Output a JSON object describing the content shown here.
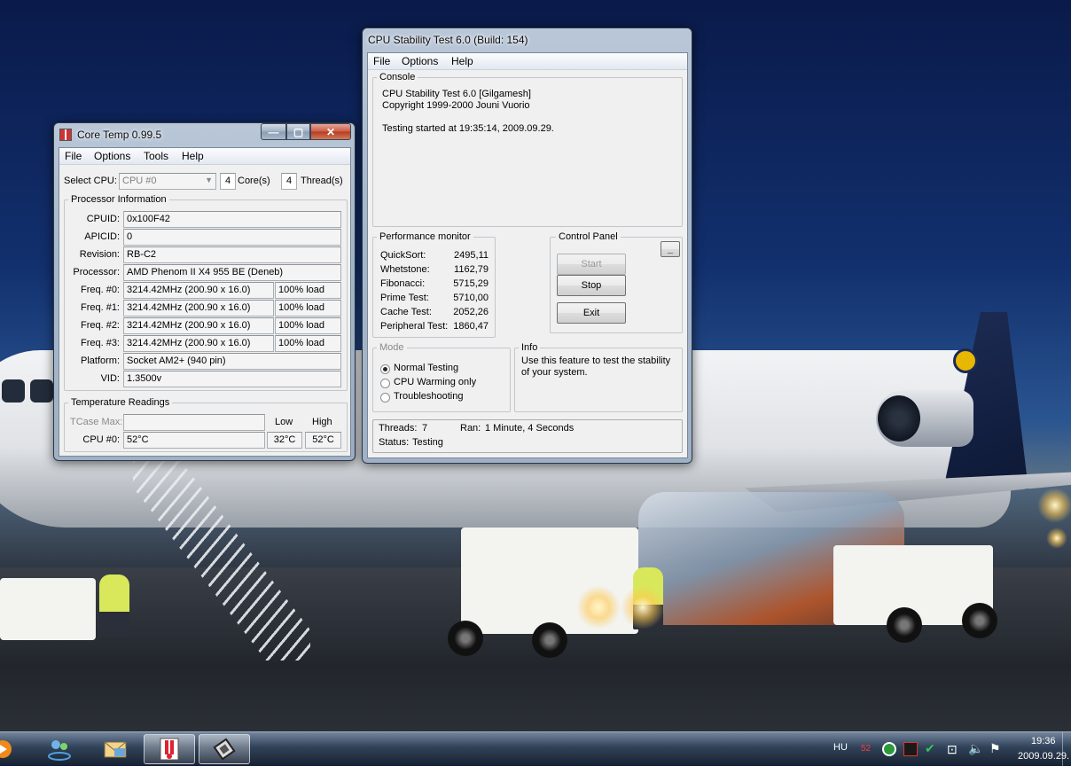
{
  "core_temp": {
    "title": "Core Temp 0.99.5",
    "menu": [
      "File",
      "Options",
      "Tools",
      "Help"
    ],
    "select_cpu_label": "Select CPU:",
    "select_cpu_value": "CPU #0",
    "cores_count": "4",
    "cores_label": "Core(s)",
    "threads_count": "4",
    "threads_label": "Thread(s)",
    "processor_info_title": "Processor Information",
    "info_rows": [
      {
        "label": "CPUID:",
        "value": "0x100F42"
      },
      {
        "label": "APICID:",
        "value": "0"
      },
      {
        "label": "Revision:",
        "value": "RB-C2"
      },
      {
        "label": "Processor:",
        "value": "AMD Phenom II X4 955 BE (Deneb)"
      }
    ],
    "freq_rows": [
      {
        "label": "Freq. #0:",
        "value": "3214.42MHz (200.90 x 16.0)",
        "load": "100% load"
      },
      {
        "label": "Freq. #1:",
        "value": "3214.42MHz (200.90 x 16.0)",
        "load": "100% load"
      },
      {
        "label": "Freq. #2:",
        "value": "3214.42MHz (200.90 x 16.0)",
        "load": "100% load"
      },
      {
        "label": "Freq. #3:",
        "value": "3214.42MHz (200.90 x 16.0)",
        "load": "100% load"
      }
    ],
    "platform_label": "Platform:",
    "platform_value": "Socket AM2+ (940 pin)",
    "vid_label": "VID:",
    "vid_value": "1.3500v",
    "temp_title": "Temperature Readings",
    "tcase_label": "TCase Max:",
    "tcase_value": "",
    "low_label": "Low",
    "high_label": "High",
    "cpu0_label": "CPU #0:",
    "cpu0_temp": "52°C",
    "cpu0_low": "32°C",
    "cpu0_high": "52°C"
  },
  "stability": {
    "title": "CPU Stability Test 6.0 (Build: 154)",
    "menu": [
      "File",
      "Options",
      "Help"
    ],
    "console_title": "Console",
    "console_lines": [
      "CPU Stability Test 6.0 [Gilgamesh]",
      "Copyright 1999-2000 Jouni Vuorio",
      "",
      "Testing started at 19:35:14, 2009.09.29."
    ],
    "perf_title": "Performance monitor",
    "perf_rows": [
      {
        "label": "QuickSort:",
        "value": "2495,11"
      },
      {
        "label": "Whetstone:",
        "value": "1162,79"
      },
      {
        "label": "Fibonacci:",
        "value": "5715,29"
      },
      {
        "label": "Prime Test:",
        "value": "5710,00"
      },
      {
        "label": "Cache Test:",
        "value": "2052,26"
      },
      {
        "label": "Peripheral Test:",
        "value": "1860,47"
      }
    ],
    "control_title": "Control Panel",
    "minimize_label": "_",
    "start_label": "Start",
    "stop_label": "Stop",
    "exit_label": "Exit",
    "mode_title": "Mode",
    "modes": [
      {
        "label": "Normal Testing",
        "selected": true
      },
      {
        "label": "CPU Warming only",
        "selected": false
      },
      {
        "label": "Troubleshooting",
        "selected": false
      }
    ],
    "info_title": "Info",
    "info_text": "Use this feature to test the stability of your system.",
    "threads_label": "Threads:",
    "threads_value": "7",
    "ran_label": "Ran:",
    "ran_value": "1 Minute, 4 Seconds",
    "status_label": "Status:",
    "status_value": "Testing"
  },
  "taskbar": {
    "language": "HU",
    "temp_badge": "52",
    "clock_time": "19:36",
    "clock_date": "2009.09.29.",
    "icons": [
      "media-player-icon",
      "network-people-icon",
      "email-icon",
      "core-temp-taskbar-icon",
      "cpu-stability-taskbar-icon"
    ]
  },
  "colors": {
    "window_frame": "#a6b8cc",
    "close_button": "#c8482f",
    "temp_badge": "#e02020"
  }
}
